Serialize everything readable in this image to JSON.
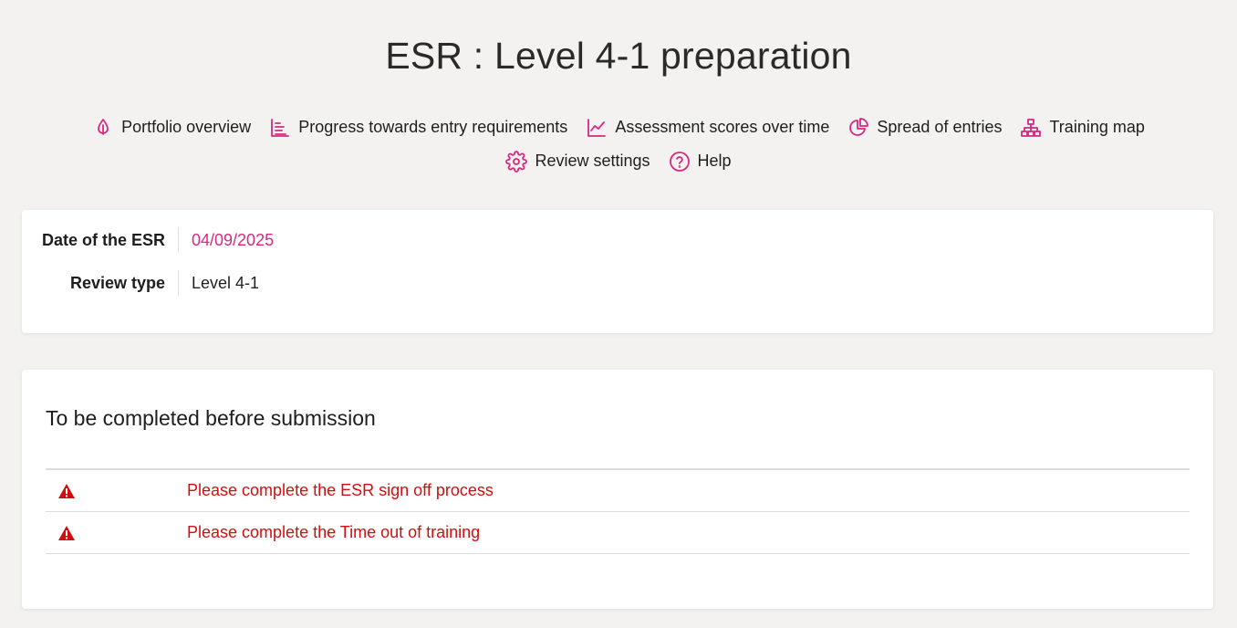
{
  "page": {
    "title": "ESR : Level 4-1 preparation"
  },
  "nav": {
    "row1": [
      {
        "label": "Portfolio overview",
        "icon": "portfolio-icon"
      },
      {
        "label": "Progress towards entry requirements",
        "icon": "bar-list-icon"
      },
      {
        "label": "Assessment scores over time",
        "icon": "line-chart-icon"
      },
      {
        "label": "Spread of entries",
        "icon": "pie-chart-icon"
      },
      {
        "label": "Training map",
        "icon": "sitemap-icon"
      }
    ],
    "row2": [
      {
        "label": "Review settings",
        "icon": "gear-icon"
      },
      {
        "label": "Help",
        "icon": "help-icon"
      }
    ]
  },
  "info": {
    "date_label": "Date of the ESR",
    "date_value": "04/09/2025",
    "type_label": "Review type",
    "type_value": "Level 4-1"
  },
  "tasks": {
    "title": "To be completed before submission",
    "items": [
      {
        "text": "Please complete the ESR sign off process"
      },
      {
        "text": "Please complete the Time out of training"
      }
    ]
  },
  "colors": {
    "accent": "#d6297f",
    "warning": "#d20f0f",
    "background": "#f3f2f1"
  }
}
